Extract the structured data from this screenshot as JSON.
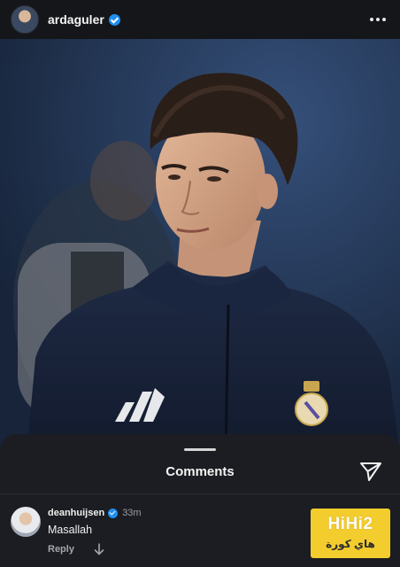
{
  "header": {
    "username": "ardaguler",
    "verified": true,
    "more_icon": "more-horizontal-icon"
  },
  "post": {
    "image_subject": "photo"
  },
  "comments_sheet": {
    "title": "Comments",
    "share_icon": "send-icon",
    "comments": [
      {
        "username": "deanhuijsen",
        "verified": true,
        "time": "33m",
        "text": "Masallah",
        "reply_label": "Reply"
      }
    ]
  },
  "watermark": {
    "brand": "HiHi2",
    "subtitle": "هاي كورة",
    "color": "#f3cc2e"
  },
  "colors": {
    "verified_blue": "#1f8ff0",
    "sheet_bg": "#1b1d22",
    "header_bg": "#14161a"
  }
}
